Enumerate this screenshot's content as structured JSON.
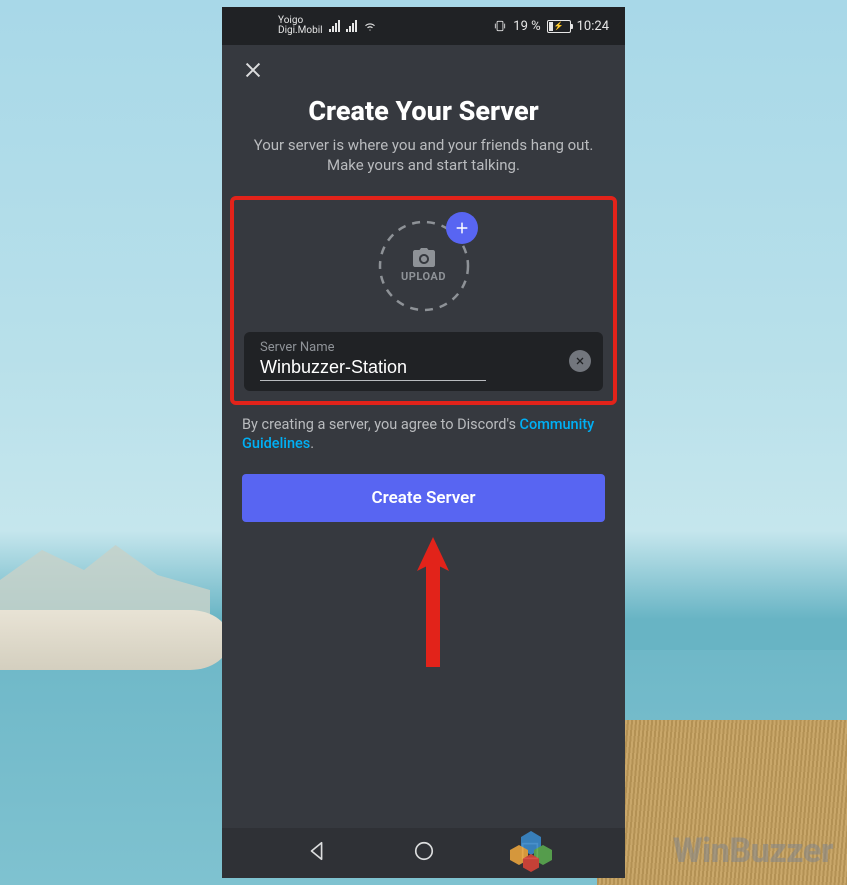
{
  "status_bar": {
    "carrier1": "Yoigo",
    "carrier2": "Digi.Mobil",
    "battery_text": "19 %",
    "time": "10:24"
  },
  "header": {
    "title": "Create Your Server",
    "subtitle": "Your server is where you and your friends hang out. Make yours and start talking."
  },
  "upload": {
    "label": "UPLOAD"
  },
  "form": {
    "server_name_label": "Server Name",
    "server_name_value": "Winbuzzer-Station"
  },
  "agreement": {
    "prefix": "By creating a server, you agree to Discord's ",
    "link_text": "Community Guidelines",
    "suffix": "."
  },
  "buttons": {
    "create_server": "Create Server"
  },
  "watermark": {
    "text": "WinBuzzer"
  },
  "colors": {
    "accent": "#5865f2",
    "annotation": "#e2231a",
    "link": "#00aff4"
  }
}
